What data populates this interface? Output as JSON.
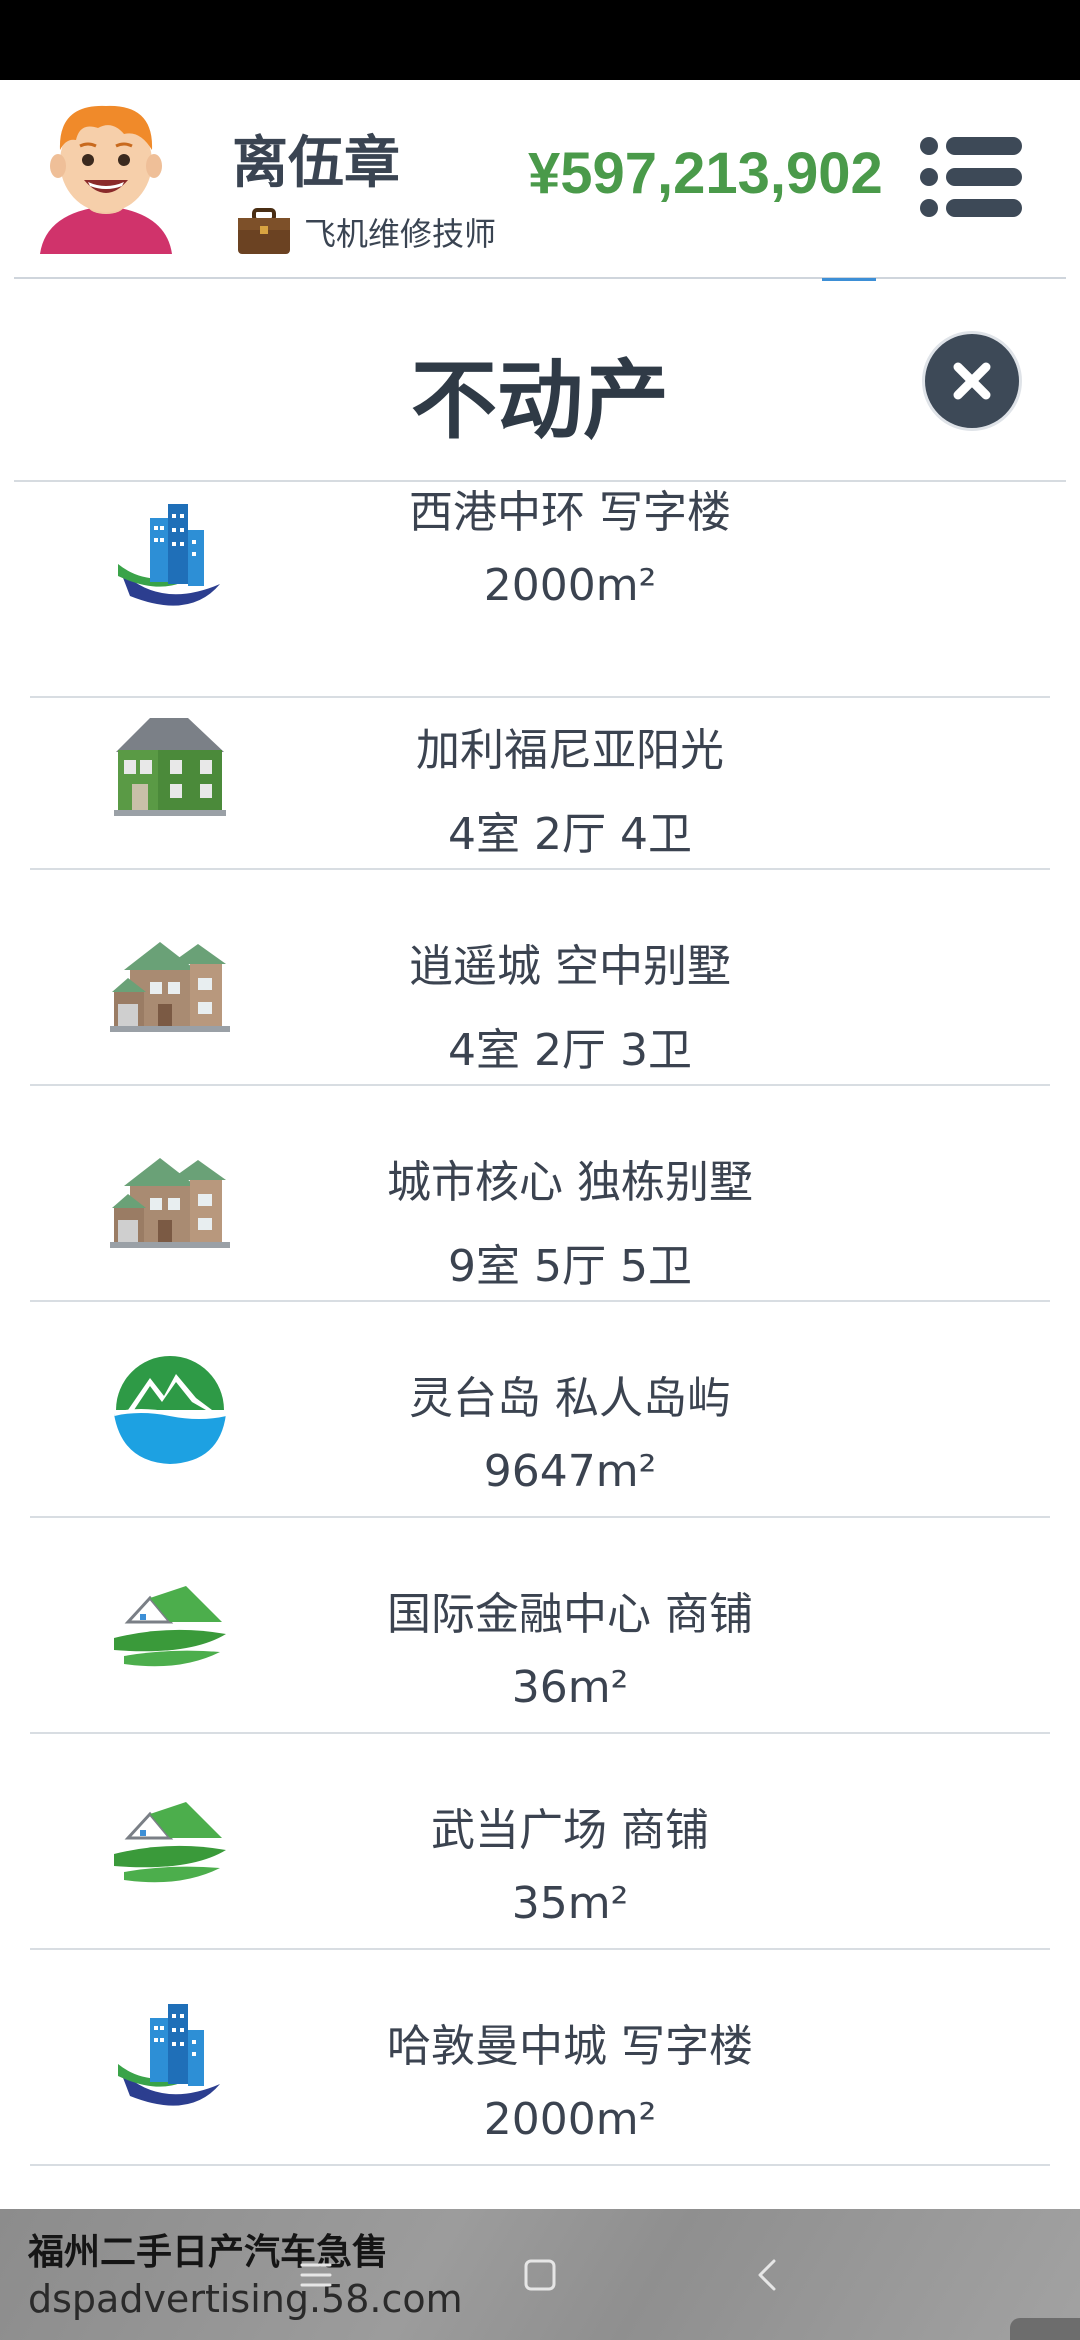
{
  "profile": {
    "name": "离伍章",
    "job": "飞机维修技师",
    "money": "¥597,213,902"
  },
  "modal": {
    "title": "不动产"
  },
  "properties": [
    {
      "name": "西港中环 写字楼",
      "size": "2000m²",
      "icon": "office-building-icon"
    },
    {
      "name": "加利福尼亚阳光",
      "size": "4室 2厅 4卫",
      "icon": "green-house-icon"
    },
    {
      "name": "逍遥城 空中别墅",
      "size": "4室 2厅 3卫",
      "icon": "villa-icon"
    },
    {
      "name": "城市核心 独栋别墅",
      "size": "9室 5厅 5卫",
      "icon": "villa-icon"
    },
    {
      "name": "灵台岛 私人岛屿",
      "size": "9647m²",
      "icon": "island-icon"
    },
    {
      "name": "国际金融中心 商铺",
      "size": "36m²",
      "icon": "shop-icon"
    },
    {
      "name": "武当广场 商铺",
      "size": "35m²",
      "icon": "shop-icon"
    },
    {
      "name": "哈敦曼中城 写字楼",
      "size": "2000m²",
      "icon": "office-building-icon"
    }
  ],
  "ad": {
    "title": "福州二手日产汽车急售",
    "url": "dspadvertising.58.com"
  },
  "colors": {
    "money": "#4a9a4a",
    "close_button": "#3d4957",
    "text": "#3b4350"
  }
}
